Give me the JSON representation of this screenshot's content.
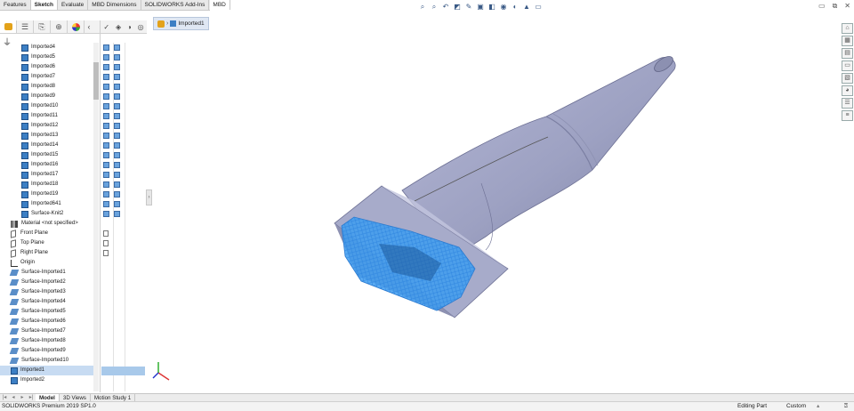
{
  "tabs": [
    "Features",
    "Sketch",
    "Evaluate",
    "MBD Dimensions",
    "SOLIDWORKS Add-Ins",
    "MBD"
  ],
  "active_tab": "Sketch",
  "breadcrumb": {
    "label": "Imported1"
  },
  "tree": {
    "items": [
      {
        "label": "Imported4",
        "icon": "cube-icon"
      },
      {
        "label": "Imported5",
        "icon": "cube-icon"
      },
      {
        "label": "Imported6",
        "icon": "cube-icon"
      },
      {
        "label": "Imported7",
        "icon": "cube-icon"
      },
      {
        "label": "Imported8",
        "icon": "cube-icon"
      },
      {
        "label": "Imported9",
        "icon": "cube-icon"
      },
      {
        "label": "Imported10",
        "icon": "cube-icon"
      },
      {
        "label": "Imported11",
        "icon": "cube-icon"
      },
      {
        "label": "Imported12",
        "icon": "cube-icon"
      },
      {
        "label": "Imported13",
        "icon": "cube-icon"
      },
      {
        "label": "Imported14",
        "icon": "cube-icon"
      },
      {
        "label": "Imported15",
        "icon": "cube-icon"
      },
      {
        "label": "Imported16",
        "icon": "cube-icon"
      },
      {
        "label": "Imported17",
        "icon": "cube-icon"
      },
      {
        "label": "Imported18",
        "icon": "cube-icon"
      },
      {
        "label": "Imported19",
        "icon": "cube-icon"
      },
      {
        "label": "Imported641",
        "icon": "cube-icon"
      },
      {
        "label": "Surface-Knit2",
        "icon": "cube-icon"
      },
      {
        "label": "Material <not specified>",
        "icon": "material-icon"
      },
      {
        "label": "Front Plane",
        "icon": "plane-icon"
      },
      {
        "label": "Top Plane",
        "icon": "plane-icon"
      },
      {
        "label": "Right Plane",
        "icon": "plane-icon"
      },
      {
        "label": "Origin",
        "icon": "origin-icon"
      },
      {
        "label": "Surface-Imported1",
        "icon": "surface-icon"
      },
      {
        "label": "Surface-Imported2",
        "icon": "surface-icon"
      },
      {
        "label": "Surface-Imported3",
        "icon": "surface-icon"
      },
      {
        "label": "Surface-Imported4",
        "icon": "surface-icon"
      },
      {
        "label": "Surface-Imported5",
        "icon": "surface-icon"
      },
      {
        "label": "Surface-Imported6",
        "icon": "surface-icon"
      },
      {
        "label": "Surface-Imported7",
        "icon": "surface-icon"
      },
      {
        "label": "Surface-Imported8",
        "icon": "surface-icon"
      },
      {
        "label": "Surface-Imported9",
        "icon": "surface-icon"
      },
      {
        "label": "Surface-Imported10",
        "icon": "surface-icon"
      },
      {
        "label": "Imported1",
        "icon": "cube-icon",
        "selected": true
      },
      {
        "label": "Imported2",
        "icon": "cube-icon"
      }
    ]
  },
  "bottom_tabs": [
    "Model",
    "3D Views",
    "Motion Study 1"
  ],
  "active_bottom_tab": "Model",
  "status": {
    "product": "SOLIDWORKS Premium 2019 SP1.0",
    "mode": "Editing Part",
    "units": "Custom"
  },
  "colors": {
    "selection": "#3d9cf0",
    "model": "#9ea3c4",
    "accent": "#3c7fc4"
  }
}
